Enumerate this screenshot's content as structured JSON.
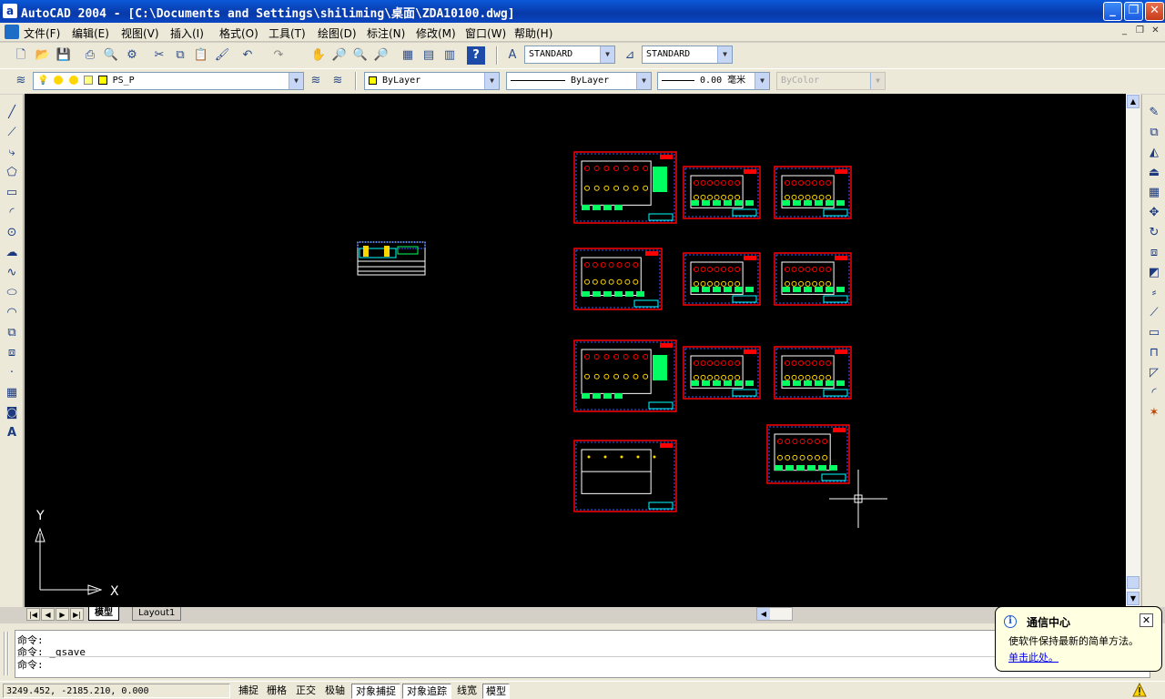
{
  "window": {
    "app_icon": "a",
    "title": "AutoCAD 2004 - [C:\\Documents and Settings\\shiliming\\桌面\\ZDA10100.dwg]",
    "buttons": {
      "minimize": "_",
      "restore": "❐",
      "close": "✕"
    }
  },
  "menu": {
    "items": [
      "文件(F)",
      "编辑(E)",
      "视图(V)",
      "插入(I)",
      "格式(O)",
      "工具(T)",
      "绘图(D)",
      "标注(N)",
      "修改(M)",
      "窗口(W)",
      "帮助(H)"
    ],
    "mdi": {
      "minimize": "_",
      "restore": "❐",
      "close": "✕"
    }
  },
  "toolbar_standard": {
    "text_style": "STANDARD",
    "dim_style": "STANDARD"
  },
  "toolbar_layers": {
    "layer": "PS_P",
    "color": "ByLayer",
    "linetype": "ByLayer",
    "lineweight": "0.00 毫米",
    "plotstyle": "ByColor"
  },
  "ucs": {
    "y_label": "Y",
    "x_label": "X"
  },
  "tabs": {
    "model": "模型",
    "layout1": "Layout1"
  },
  "command": {
    "lines": [
      "命令:",
      "命令: _qsave",
      "命令:"
    ]
  },
  "status": {
    "coords": "3249.452, -2185.210, 0.000",
    "buttons": [
      {
        "label": "捕捉",
        "on": false
      },
      {
        "label": "栅格",
        "on": false
      },
      {
        "label": "正交",
        "on": false
      },
      {
        "label": "极轴",
        "on": false
      },
      {
        "label": "对象捕捉",
        "on": true
      },
      {
        "label": "对象追踪",
        "on": true
      },
      {
        "label": "线宽",
        "on": false
      },
      {
        "label": "模型",
        "on": true
      }
    ]
  },
  "balloon": {
    "title": "通信中心",
    "body": "使软件保持最新的简单方法。",
    "link": "单击此处。",
    "close": "✕",
    "icon": "i"
  },
  "colors": {
    "canvas": "#000000",
    "frame": "#ff0000",
    "drawing_dash": "#3060ff",
    "cyan": "#00ffff",
    "green": "#00ff60",
    "yellow": "#ffd700",
    "title_bar": "#0a58d8"
  }
}
